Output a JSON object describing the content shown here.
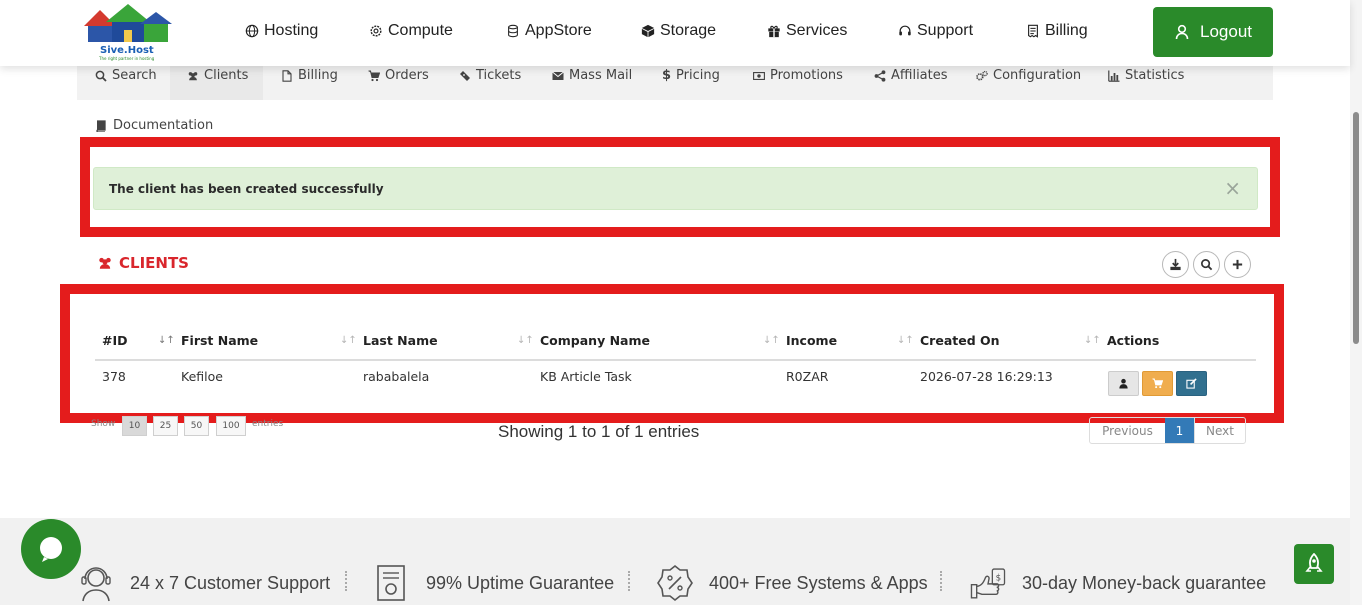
{
  "brand": {
    "name": "Sive.Host",
    "tagline": "The right partner in hosting"
  },
  "nav": [
    {
      "label": "Hosting",
      "icon": "globe-icon"
    },
    {
      "label": "Compute",
      "icon": "gear-icon"
    },
    {
      "label": "AppStore",
      "icon": "database-icon"
    },
    {
      "label": "Storage",
      "icon": "cube-icon"
    },
    {
      "label": "Services",
      "icon": "gift-icon"
    },
    {
      "label": "Support",
      "icon": "headset-icon"
    },
    {
      "label": "Billing",
      "icon": "receipt-icon"
    }
  ],
  "logout_label": "Logout",
  "admin_menu": [
    {
      "label": "Search",
      "icon": "search-icon"
    },
    {
      "label": "Clients",
      "icon": "users-icon",
      "active": true
    },
    {
      "label": "Billing",
      "icon": "file-icon"
    },
    {
      "label": "Orders",
      "icon": "cart-icon"
    },
    {
      "label": "Tickets",
      "icon": "ticket-icon"
    },
    {
      "label": "Mass Mail",
      "icon": "envelope-icon"
    },
    {
      "label": "Pricing",
      "icon": "dollar-icon"
    },
    {
      "label": "Promotions",
      "icon": "money-icon"
    },
    {
      "label": "Affiliates",
      "icon": "share-icon"
    },
    {
      "label": "Configuration",
      "icon": "cogs-icon"
    },
    {
      "label": "Statistics",
      "icon": "bar-chart-icon"
    }
  ],
  "documentation_label": "Documentation",
  "alert": {
    "message": "The client has been created successfully",
    "close": "×"
  },
  "clients_title": "CLIENTS",
  "table": {
    "columns": [
      "#ID",
      "First Name",
      "Last Name",
      "Company Name",
      "Income",
      "Created On",
      "Actions"
    ],
    "rows": [
      {
        "id": "378",
        "first_name": "Kefiloe",
        "last_name": "rababalela",
        "company": "KB Article Task",
        "income": "R0ZAR",
        "created_on": "2026-07-28 16:29:13"
      }
    ]
  },
  "pagination": {
    "show_label": "Show",
    "lengths": [
      "10",
      "25",
      "50",
      "100"
    ],
    "entries_label": "entries",
    "summary": "Showing 1 to 1 of 1 entries",
    "previous": "Previous",
    "current_page": "1",
    "next": "Next"
  },
  "features": [
    {
      "label": "24 x 7 Customer Support",
      "icon": "support-agent-icon"
    },
    {
      "label": "99% Uptime Guarantee",
      "icon": "certificate-icon"
    },
    {
      "label": "400+ Free Systems & Apps",
      "icon": "percent-badge-icon"
    },
    {
      "label": "30-day Money-back guarantee",
      "icon": "money-back-icon"
    }
  ],
  "colors": {
    "brand_green": "#2a8a2a",
    "highlight_red": "#e41c1c",
    "clients_red": "#d9262c",
    "pager_blue": "#337ab7",
    "alert_bg": "#dff0d8"
  }
}
